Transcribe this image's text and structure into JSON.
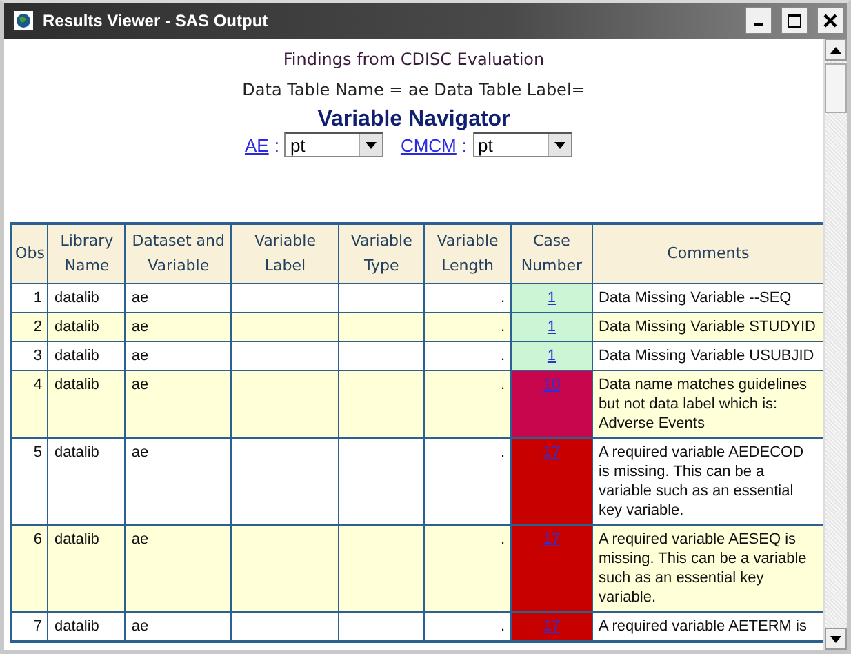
{
  "window": {
    "title": "Results Viewer - SAS Output"
  },
  "header": {
    "title": "Findings from CDISC Evaluation",
    "subtitle": "Data Table Name = ae Data Table Label=",
    "navigator": "Variable Navigator"
  },
  "navigator": [
    {
      "link": "AE",
      "separator": ":",
      "value": "pt"
    },
    {
      "link": "CMCM",
      "separator": ":",
      "value": "pt"
    }
  ],
  "table": {
    "columns": [
      "Obs",
      "Library Name",
      "Dataset and Variable",
      "Variable Label",
      "Variable Type",
      "Variable Length",
      "Case Number",
      "Comments"
    ],
    "rows": [
      {
        "obs": "1",
        "library": "datalib",
        "dataset": "ae",
        "length": ".",
        "case": "1",
        "color": "#ccf5d6",
        "comment": "Data Missing Variable --SEQ"
      },
      {
        "obs": "2",
        "library": "datalib",
        "dataset": "ae",
        "length": ".",
        "case": "1",
        "color": "#ccf5d6",
        "comment": "Data Missing Variable STUDYID"
      },
      {
        "obs": "3",
        "library": "datalib",
        "dataset": "ae",
        "length": ".",
        "case": "1",
        "color": "#ccf5d6",
        "comment": "Data Missing Variable USUBJID"
      },
      {
        "obs": "4",
        "library": "datalib",
        "dataset": "ae",
        "length": ".",
        "case": "10",
        "color": "#c8064e",
        "comment": "Data name matches guidelines but not data label which is: Adverse Events"
      },
      {
        "obs": "5",
        "library": "datalib",
        "dataset": "ae",
        "length": ".",
        "case": "17",
        "color": "#c80000",
        "comment": "A required variable AEDECOD is missing. This can be a variable such as an essential key variable."
      },
      {
        "obs": "6",
        "library": "datalib",
        "dataset": "ae",
        "length": ".",
        "case": "17",
        "color": "#c80000",
        "comment": "A required variable AESEQ is missing. This can be a variable such as an essential key variable."
      },
      {
        "obs": "7",
        "library": "datalib",
        "dataset": "ae",
        "length": ".",
        "case": "17",
        "color": "#c80000",
        "comment": "A required variable AETERM is"
      }
    ]
  }
}
